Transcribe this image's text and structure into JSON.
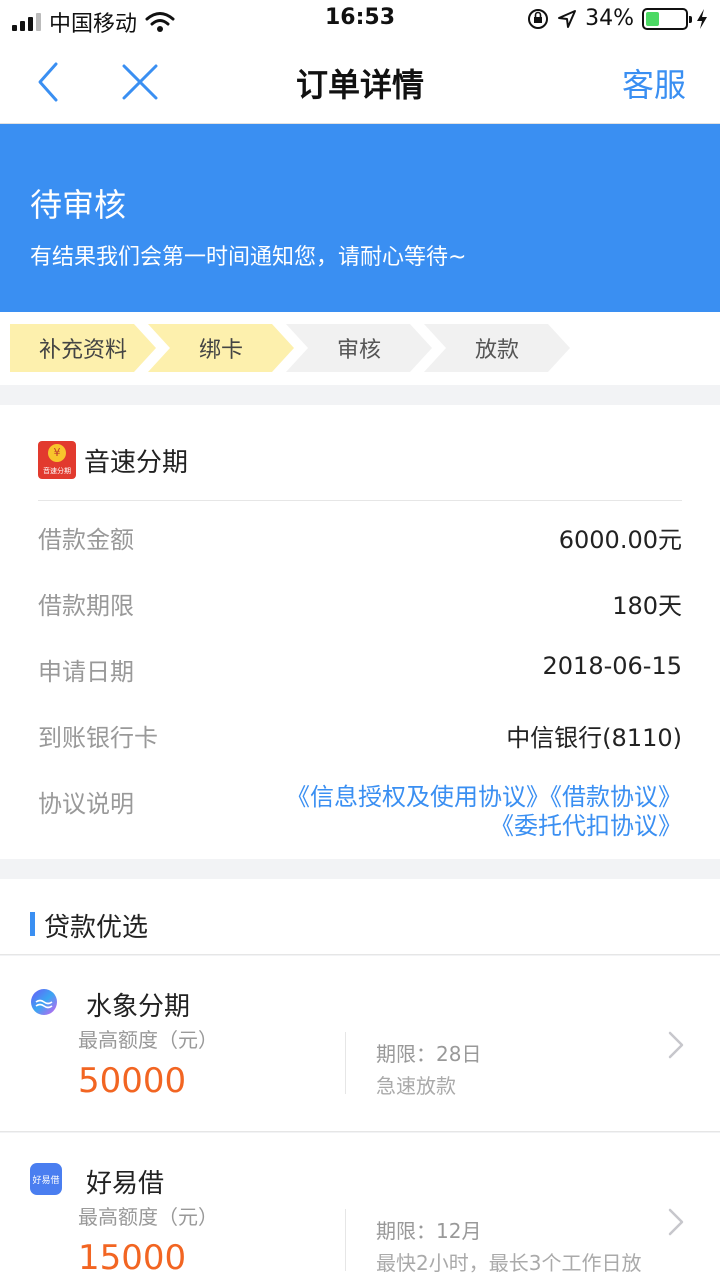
{
  "status_bar": {
    "carrier": "中国移动",
    "time": "16:53",
    "battery": "34%",
    "battery_level": 0.34
  },
  "nav": {
    "title": "订单详情",
    "service": "客服"
  },
  "banner": {
    "title": "待审核",
    "desc": "有结果我们会第一时间通知您，请耐心等待~"
  },
  "steps": [
    {
      "label": "补充资料",
      "done": true
    },
    {
      "label": "绑卡",
      "done": true
    },
    {
      "label": "审核",
      "done": false
    },
    {
      "label": "放款",
      "done": false
    }
  ],
  "order": {
    "merchant_name": "音速分期",
    "logo_text": "音速分期",
    "rows": [
      {
        "label": "借款金额",
        "value": "6000.00元"
      },
      {
        "label": "借款期限",
        "value": "180天"
      },
      {
        "label": "申请日期",
        "value": "2018-06-15"
      },
      {
        "label": "到账银行卡",
        "value": "中信银行(8110)"
      }
    ],
    "agreement_label": "协议说明",
    "agreements": [
      "《信息授权及使用协议》",
      "《借款协议》",
      "《委托代扣协议》"
    ]
  },
  "recommend": {
    "title": "贷款优选",
    "items": [
      {
        "name": "水象分期",
        "caption": "最高额度（元）",
        "amount": "50000",
        "term": "期限：28日",
        "note": "急速放款"
      },
      {
        "name": "好易借",
        "icon_text": "好易借",
        "caption": "最高额度（元）",
        "amount": "15000",
        "term": "期限：12月",
        "note": "最快2小时，最长3个工作日放"
      }
    ]
  },
  "colors": {
    "accent": "#3a8ff2",
    "step_done": "#fdf0ad",
    "amount": "#f26522"
  }
}
